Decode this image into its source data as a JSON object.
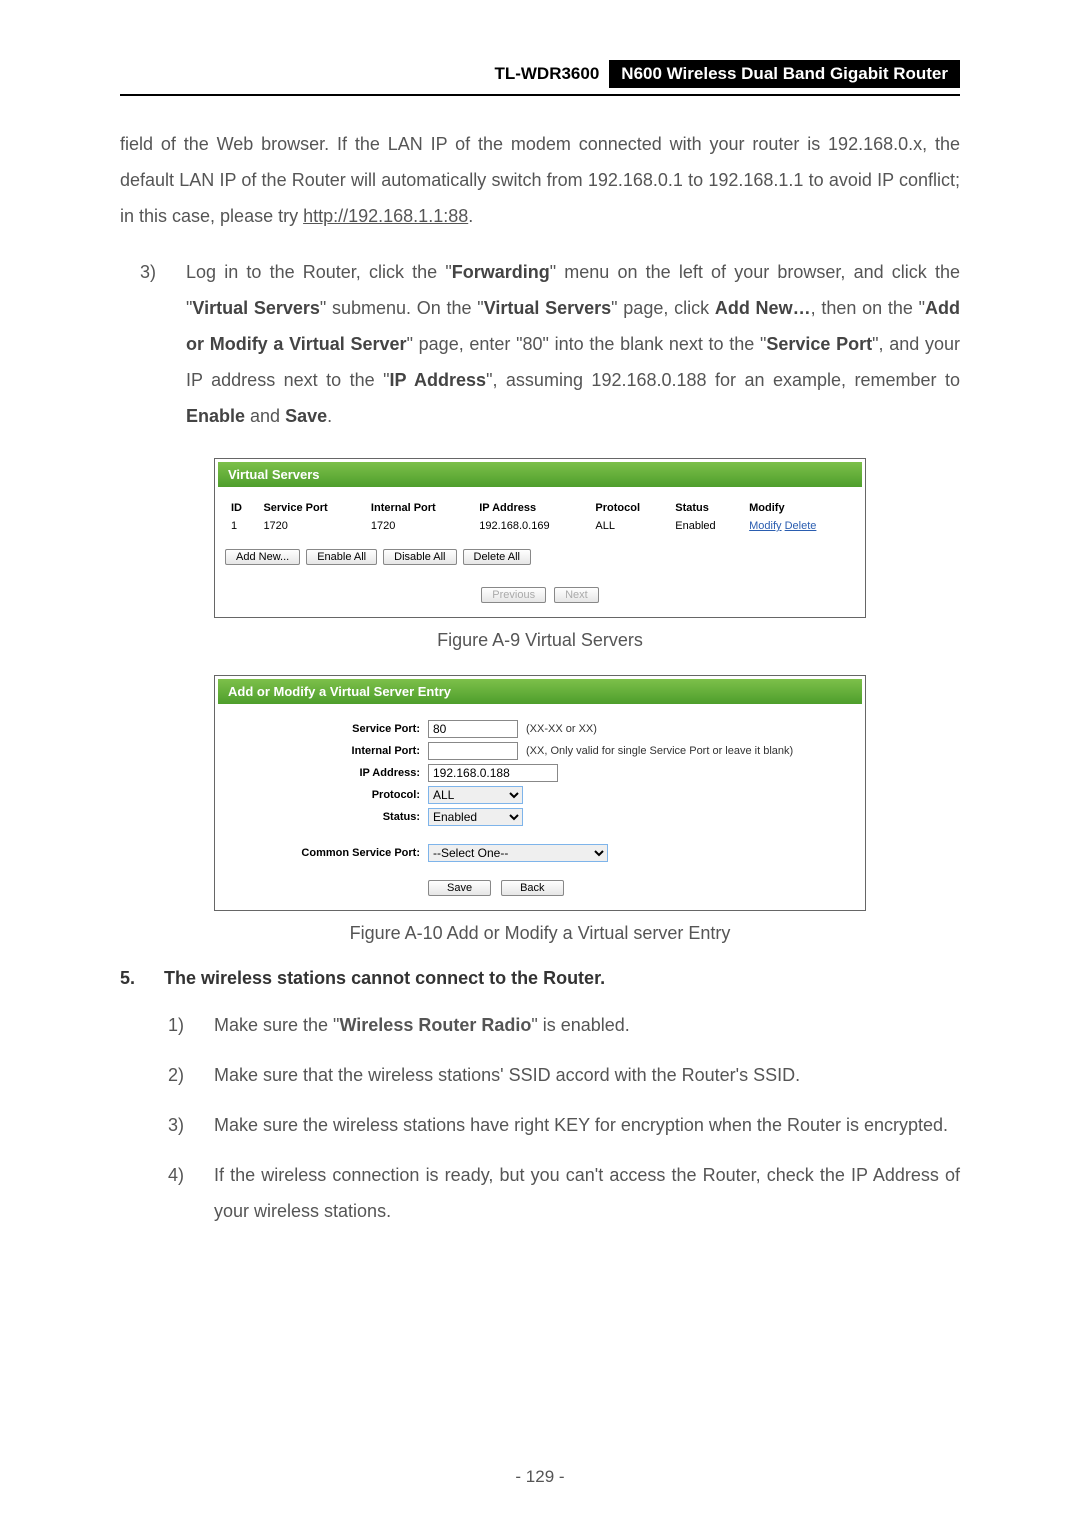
{
  "header": {
    "model": "TL-WDR3600",
    "product": "N600 Wireless Dual Band Gigabit Router"
  },
  "intro": {
    "p1a": "field of the Web browser. If the LAN IP of the modem connected with your router is 192.168.0.x, the default LAN IP of the Router will automatically switch from 192.168.0.1 to 192.168.1.1 to avoid IP conflict; in this case, please try ",
    "link": "http://192.168.1.1:88",
    "p1b": "."
  },
  "step3": {
    "num": "3)",
    "t1": "Log in to the Router, click the \"",
    "b1": "Forwarding",
    "t2": "\" menu on the left of your browser, and click the \"",
    "b2": "Virtual Servers",
    "t3": "\" submenu. On the \"",
    "b3": "Virtual Servers",
    "t4": "\" page, click ",
    "b4": "Add New…",
    "t5": ", then on the \"",
    "b5": "Add or Modify a Virtual Server",
    "t6": "\" page, enter \"80\" into the blank next to the \"",
    "b6": "Service Port",
    "t7": "\", and your IP address next to the \"",
    "b7": "IP Address",
    "t8": "\", assuming 192.168.0.188 for an example, remember to ",
    "b8": "Enable",
    "t9": " and ",
    "b9": "Save",
    "t10": "."
  },
  "fig1": {
    "title": "Virtual Servers",
    "headers": {
      "id": "ID",
      "sp": "Service Port",
      "ip": "Internal Port",
      "addr": "IP Address",
      "proto": "Protocol",
      "status": "Status",
      "mod": "Modify"
    },
    "row": {
      "id": "1",
      "sp": "1720",
      "ip": "1720",
      "addr": "192.168.0.169",
      "proto": "ALL",
      "status": "Enabled",
      "modify": "Modify",
      "delete": "Delete"
    },
    "buttons": {
      "add": "Add New...",
      "ena": "Enable All",
      "dis": "Disable All",
      "del": "Delete All",
      "prev": "Previous",
      "next": "Next"
    },
    "caption": "Figure A-9 Virtual Servers"
  },
  "fig2": {
    "title": "Add or Modify a Virtual Server Entry",
    "labels": {
      "sp": "Service Port:",
      "ip": "Internal Port:",
      "addr": "IP Address:",
      "proto": "Protocol:",
      "status": "Status:",
      "csp": "Common Service Port:"
    },
    "values": {
      "sp": "80",
      "ip": "",
      "addr": "192.168.0.188",
      "proto": "ALL",
      "status": "Enabled",
      "csp": "--Select One--"
    },
    "hints": {
      "sp": "(XX-XX or XX)",
      "ip": "(XX, Only valid for single Service Port or leave it blank)"
    },
    "buttons": {
      "save": "Save",
      "back": "Back"
    },
    "caption": "Figure A-10 Add or Modify a Virtual server Entry"
  },
  "q5": {
    "num": "5.",
    "title": "The wireless stations cannot connect to the Router.",
    "items": [
      {
        "n": "1)",
        "pre": "Make sure the \"",
        "b": "Wireless Router Radio",
        "post": "\" is enabled."
      },
      {
        "n": "2)",
        "pre": "Make sure that the wireless stations' SSID accord with the Router's SSID.",
        "b": "",
        "post": ""
      },
      {
        "n": "3)",
        "pre": "Make sure the wireless stations have right KEY for encryption when the Router is encrypted.",
        "b": "",
        "post": ""
      },
      {
        "n": "4)",
        "pre": "If the wireless connection is ready, but you can't access the Router, check the IP Address of your wireless stations.",
        "b": "",
        "post": ""
      }
    ]
  },
  "pagenum": "- 129 -"
}
